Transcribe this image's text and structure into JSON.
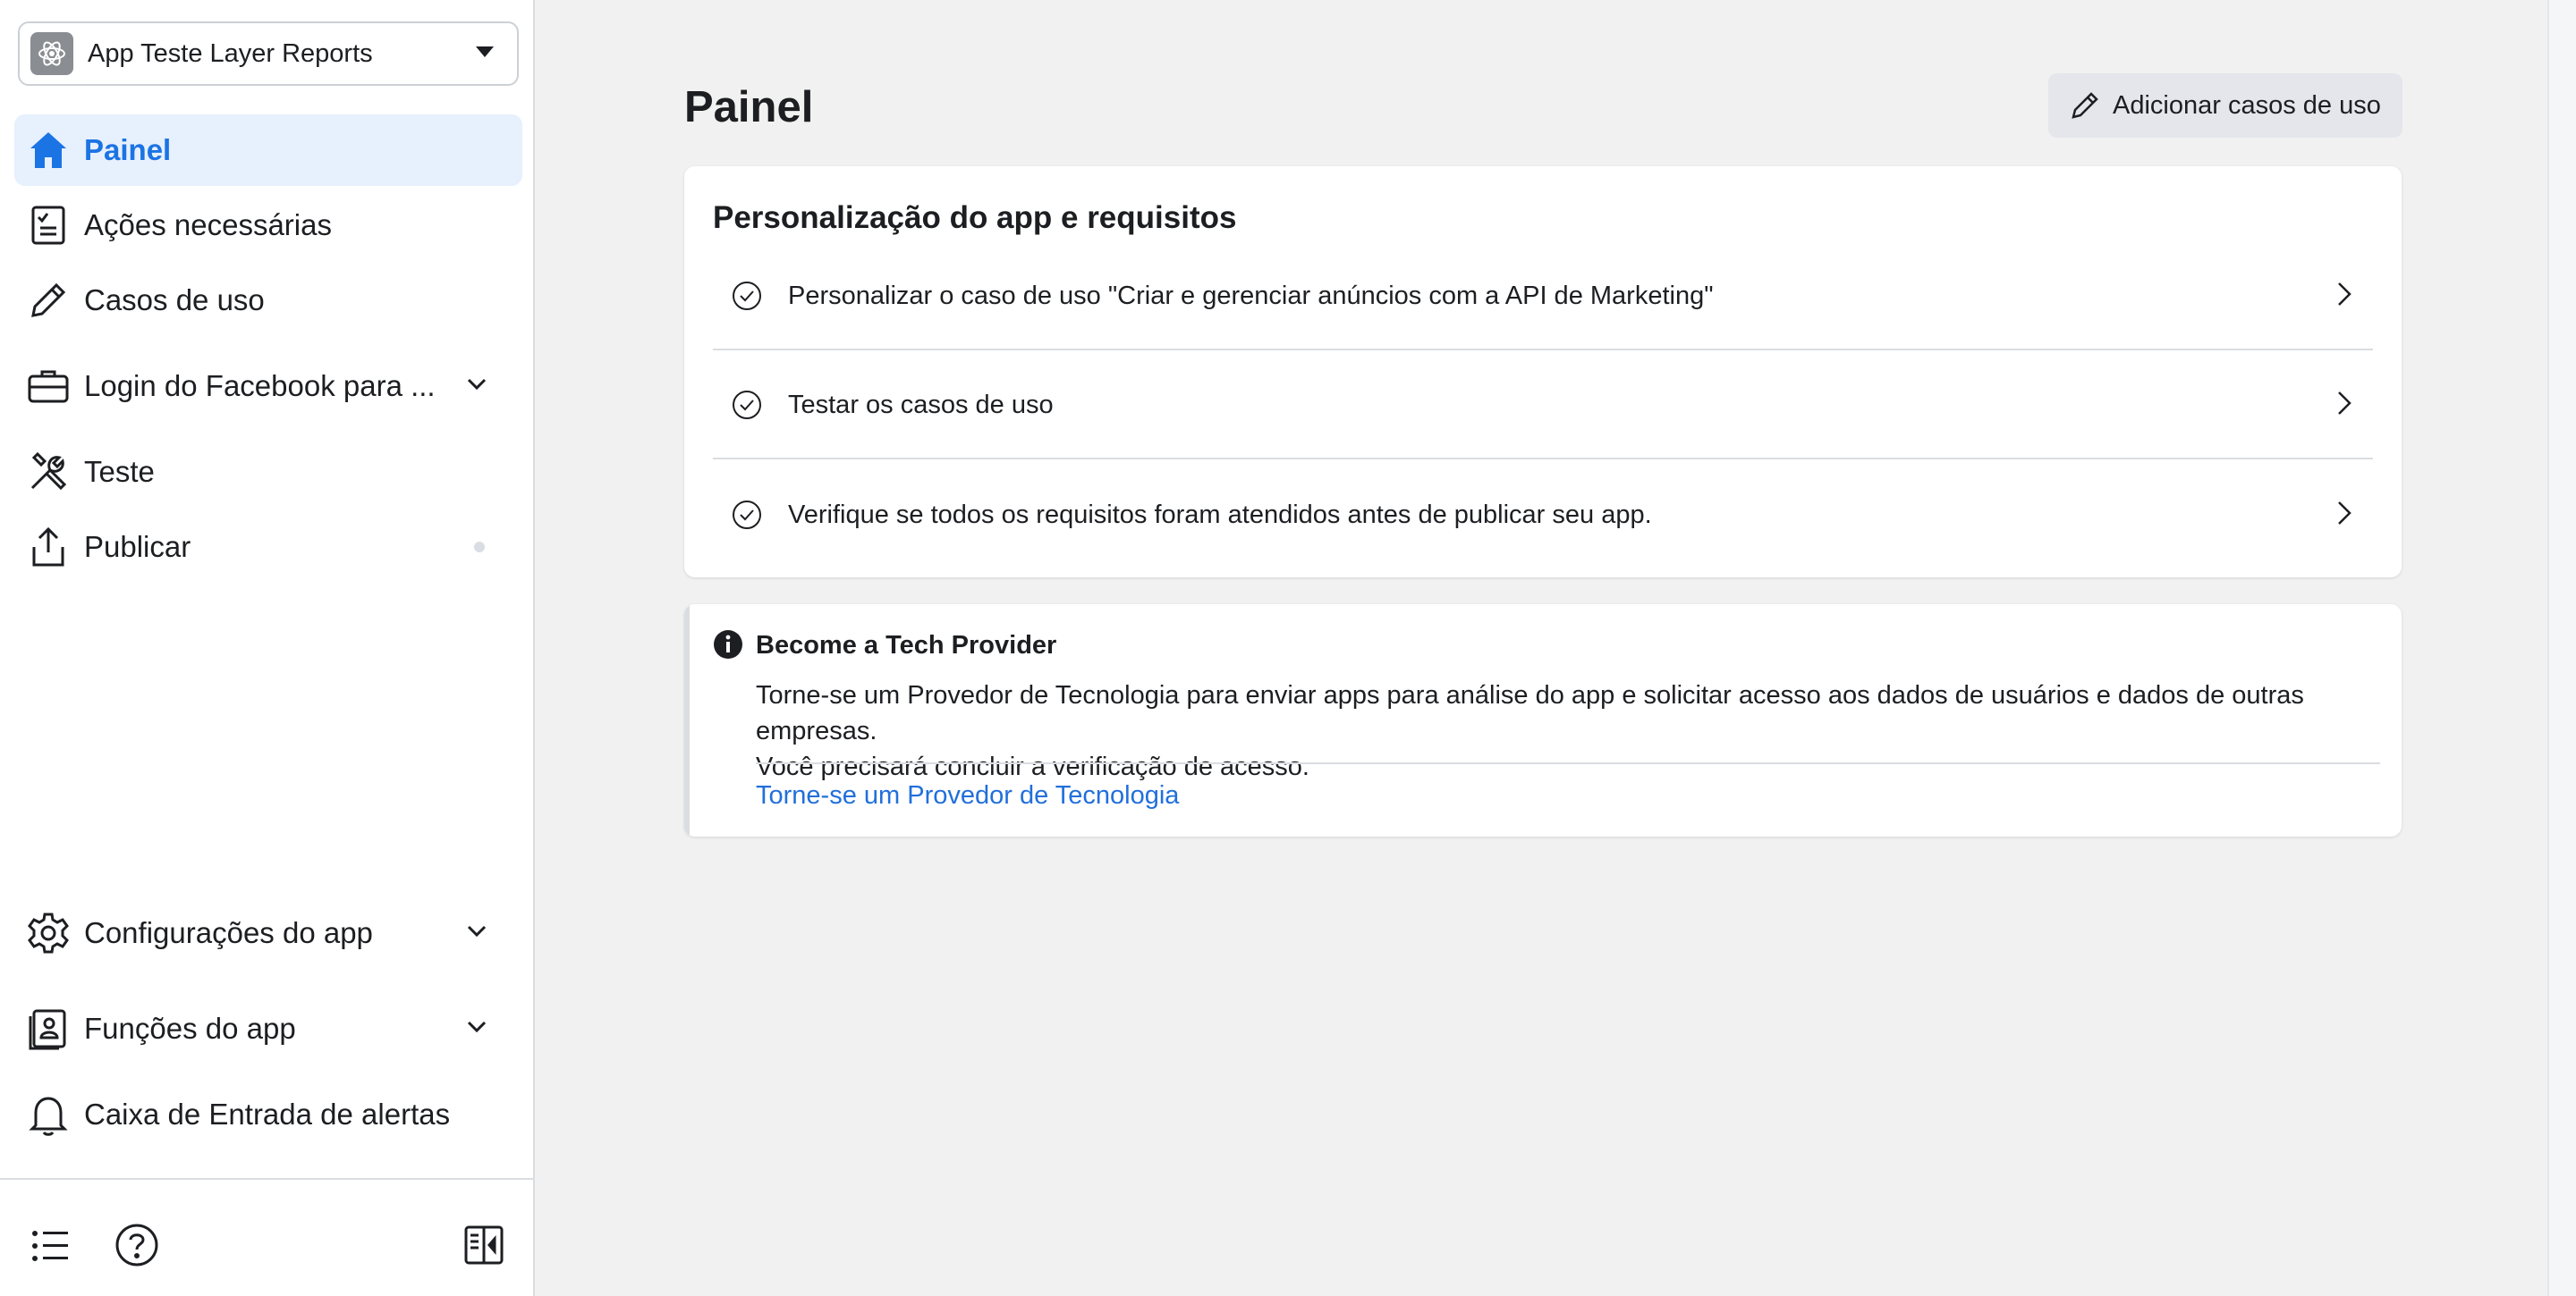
{
  "app_selector": {
    "name": "App Teste Layer Reports"
  },
  "sidebar": {
    "items": [
      {
        "label": "Painel",
        "icon": "home-icon",
        "active": true
      },
      {
        "label": "Ações necessárias",
        "icon": "checklist-icon"
      },
      {
        "label": "Casos de uso",
        "icon": "pencil-icon"
      },
      {
        "label": "Login do Facebook para ...",
        "icon": "briefcase-icon"
      },
      {
        "label": "Teste",
        "icon": "tools-icon"
      },
      {
        "label": "Publicar",
        "icon": "upload-icon"
      },
      {
        "label": "Configurações do app",
        "icon": "gear-icon"
      },
      {
        "label": "Funções do app",
        "icon": "id-card-icon"
      },
      {
        "label": "Caixa de Entrada de alertas",
        "icon": "bell-icon"
      }
    ]
  },
  "main": {
    "title": "Painel",
    "add_button_label": "Adicionar casos de uso",
    "requirements_card": {
      "title": "Personalização do app e requisitos",
      "rows": [
        {
          "text": "Personalizar o caso de uso \"Criar e gerenciar anúncios com a API de Marketing\""
        },
        {
          "text": "Testar os casos de uso"
        },
        {
          "text": "Verifique se todos os requisitos foram atendidos antes de publicar seu app."
        }
      ]
    },
    "tech_provider_card": {
      "title": "Become a Tech Provider",
      "description_line1": "Torne-se um Provedor de Tecnologia para enviar apps para análise do app e solicitar acesso aos dados de usuários e dados de outras empresas.",
      "description_line2": "Você precisará concluir a verificação de acesso.",
      "link": "Torne-se um Provedor de Tecnologia"
    }
  },
  "colors": {
    "accent": "#1b74e4",
    "link": "#216fdb",
    "active_bg": "#e7f0fd",
    "page_bg": "#f1f1f1"
  }
}
